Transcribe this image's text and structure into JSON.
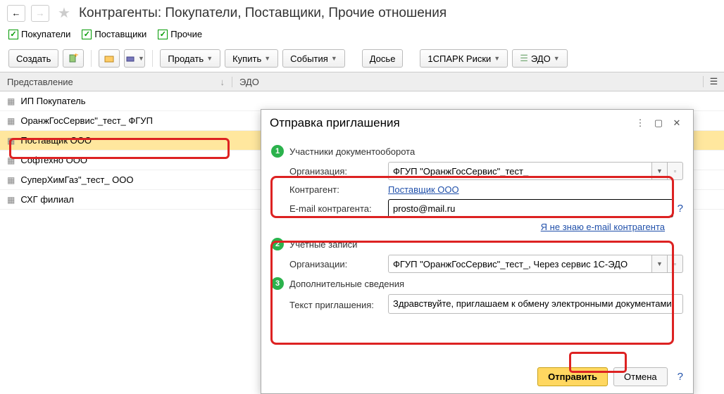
{
  "header": {
    "title": "Контрагенты: Покупатели, Поставщики, Прочие отношения"
  },
  "checks": [
    {
      "label": "Покупатели"
    },
    {
      "label": "Поставщики"
    },
    {
      "label": "Прочие"
    }
  ],
  "toolbar": {
    "create": "Создать",
    "sell": "Продать",
    "buy": "Купить",
    "events": "События",
    "dossier": "Досье",
    "spark": "1СПАРК Риски",
    "edo": "ЭДО"
  },
  "table": {
    "col1": "Представление",
    "col2": "ЭДО",
    "rows": [
      "ИП Покупатель",
      "ОранжГосСервис\"_тест_ ФГУП",
      "Поставщик ООО",
      "Софтехно ООО",
      "СуперХимГаз\"_тест_ ООО",
      "СХГ филиал"
    ]
  },
  "dialog": {
    "title": "Отправка приглашения",
    "s1": "Участники документооборота",
    "org_label": "Организация:",
    "org_value": "ФГУП \"ОранжГосСервис\"_тест_",
    "contr_label": "Контрагент:",
    "contr_value": "Поставщик ООО",
    "email_label": "E-mail контрагента:",
    "email_value": "prosto@mail.ru",
    "no_email": "Я не знаю e-mail контрагента",
    "s2": "Учетные записи",
    "accounts_label": "Организации:",
    "accounts_value": "ФГУП \"ОранжГосСервис\"_тест_, Через сервис 1С-ЭДО",
    "s3": "Дополнительные сведения",
    "text_label": "Текст приглашения:",
    "text_value": "Здравствуйте, приглашаем к обмену электронными документами.",
    "send": "Отправить",
    "cancel": "Отмена"
  }
}
